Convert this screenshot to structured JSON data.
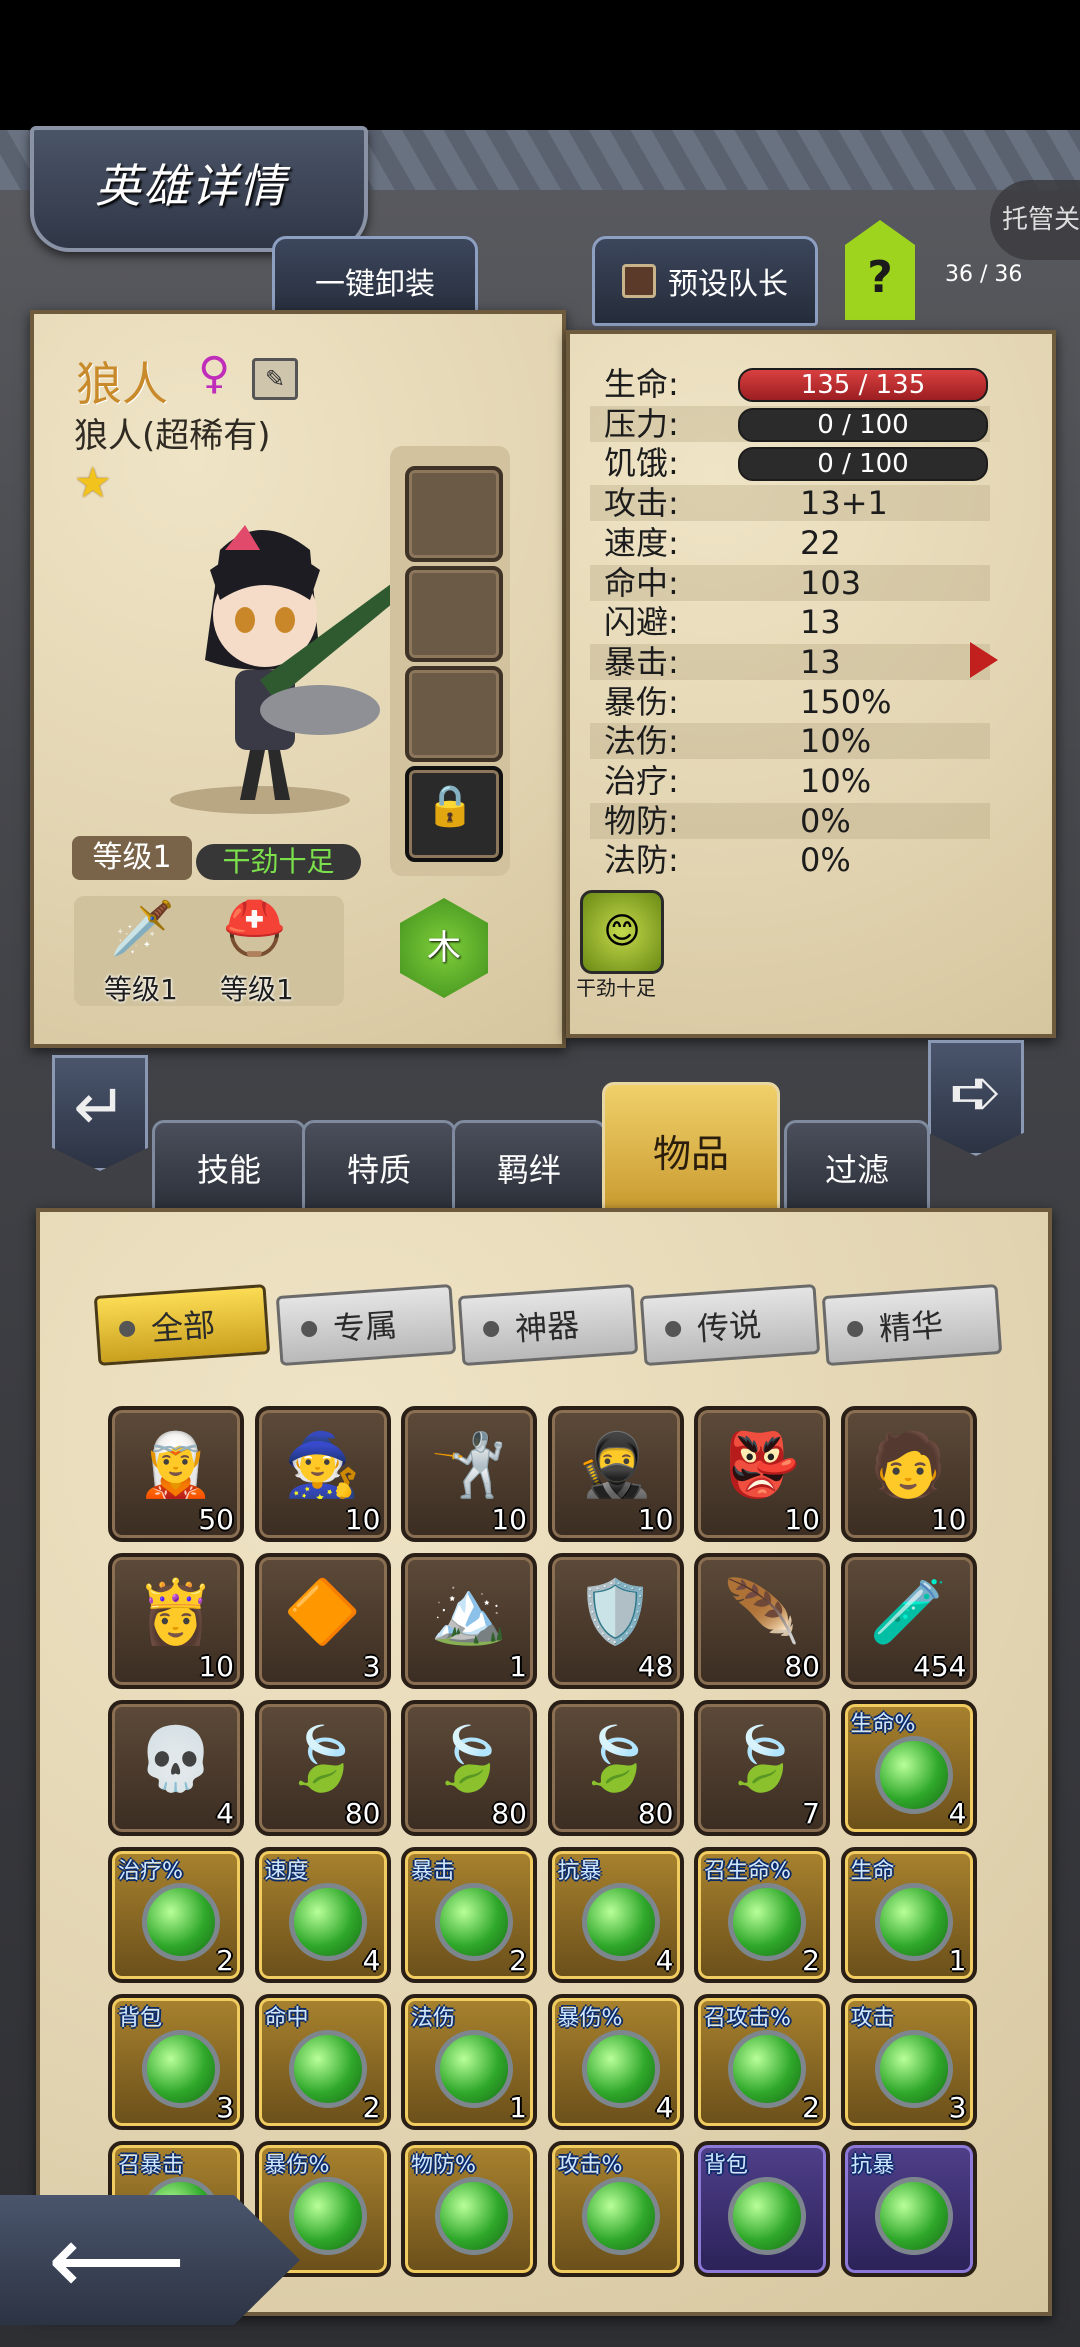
{
  "header": {
    "title": "英雄详情",
    "auto_label": "托管关"
  },
  "top_actions": {
    "unequip_all": "一键卸装",
    "set_leader": "预设队长",
    "help": "?",
    "count": "36 / 36"
  },
  "hero": {
    "name": "狼人",
    "subtitle": "狼人(超稀有)",
    "level": "等级1",
    "trait": "干劲十足",
    "element": "木",
    "equipment": [
      {
        "label": "等级1",
        "icon": "sword-icon"
      },
      {
        "label": "等级1",
        "icon": "helmet-icon"
      }
    ]
  },
  "stats": [
    {
      "label": "生命:",
      "value": "135 / 135",
      "bar": "red"
    },
    {
      "label": "压力:",
      "value": "0 / 100",
      "bar": "dark"
    },
    {
      "label": "饥饿:",
      "value": "0 / 100",
      "bar": "dark"
    },
    {
      "label": "攻击:",
      "value": "13+1"
    },
    {
      "label": "速度:",
      "value": "22"
    },
    {
      "label": "命中:",
      "value": "103"
    },
    {
      "label": "闪避:",
      "value": "13"
    },
    {
      "label": "暴击:",
      "value": "13"
    },
    {
      "label": "暴伤:",
      "value": "150%"
    },
    {
      "label": "法伤:",
      "value": "10%"
    },
    {
      "label": "治疗:",
      "value": "10%"
    },
    {
      "label": "物防:",
      "value": "0%"
    },
    {
      "label": "法防:",
      "value": "0%"
    }
  ],
  "trait_badge_label": "干劲十足",
  "tabs": [
    "技能",
    "特质",
    "羁绊",
    "物品",
    "过滤"
  ],
  "active_tab": "物品",
  "filters": [
    "全部",
    "专属",
    "神器",
    "传说",
    "精华"
  ],
  "items": [
    {
      "glyph": "🧝",
      "count": "50"
    },
    {
      "glyph": "🧙",
      "count": "10"
    },
    {
      "glyph": "🤺",
      "count": "10"
    },
    {
      "glyph": "🥷",
      "count": "10"
    },
    {
      "glyph": "👺",
      "count": "10"
    },
    {
      "glyph": "🧑",
      "count": "10"
    },
    {
      "glyph": "👸",
      "count": "10"
    },
    {
      "glyph": "🔶",
      "count": "3"
    },
    {
      "glyph": "🏔️",
      "count": "1"
    },
    {
      "glyph": "🛡️",
      "count": "48"
    },
    {
      "glyph": "🪶",
      "count": "80"
    },
    {
      "glyph": "🧪",
      "count": "454"
    },
    {
      "glyph": "💀",
      "count": "4"
    },
    {
      "glyph": "🍃",
      "count": "80"
    },
    {
      "glyph": "🍃",
      "count": "80"
    },
    {
      "glyph": "🍃",
      "count": "80"
    },
    {
      "glyph": "🍃",
      "count": "7"
    },
    {
      "tag": "生命%",
      "count": "4",
      "gem": true,
      "style": "gold"
    },
    {
      "tag": "治疗%",
      "count": "2",
      "gem": true,
      "style": "gold"
    },
    {
      "tag": "速度",
      "count": "4",
      "gem": true,
      "style": "gold"
    },
    {
      "tag": "暴击",
      "count": "2",
      "gem": true,
      "style": "gold"
    },
    {
      "tag": "抗暴",
      "count": "4",
      "gem": true,
      "style": "gold"
    },
    {
      "tag": "召生命%",
      "count": "2",
      "gem": true,
      "style": "gold"
    },
    {
      "tag": "生命",
      "count": "1",
      "gem": true,
      "style": "gold"
    },
    {
      "tag": "背包",
      "count": "3",
      "gem": true,
      "style": "gold"
    },
    {
      "tag": "命中",
      "count": "2",
      "gem": true,
      "style": "gold"
    },
    {
      "tag": "法伤",
      "count": "1",
      "gem": true,
      "style": "gold"
    },
    {
      "tag": "暴伤%",
      "count": "4",
      "gem": true,
      "style": "gold"
    },
    {
      "tag": "召攻击%",
      "count": "2",
      "gem": true,
      "style": "gold"
    },
    {
      "tag": "攻击",
      "count": "3",
      "gem": true,
      "style": "gold"
    },
    {
      "tag": "召暴击",
      "count": "",
      "gem": true,
      "style": "gold"
    },
    {
      "tag": "暴伤%",
      "count": "",
      "gem": true,
      "style": "gold"
    },
    {
      "tag": "物防%",
      "count": "",
      "gem": true,
      "style": "gold"
    },
    {
      "tag": "攻击%",
      "count": "",
      "gem": true,
      "style": "gold"
    },
    {
      "tag": "背包",
      "count": "",
      "gem": true,
      "style": "purple"
    },
    {
      "tag": "抗暴",
      "count": "",
      "gem": true,
      "style": "purple"
    }
  ]
}
